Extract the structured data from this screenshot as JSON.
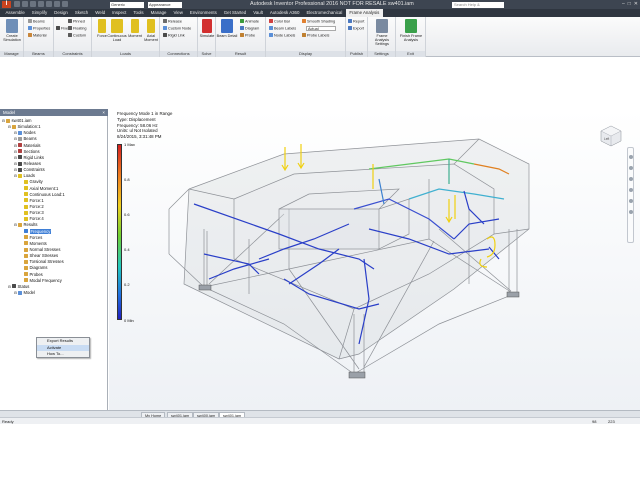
{
  "titlebar": {
    "title": "Autodesk Inventor Professional 2016    NOT FOR RESALE    sw401.iam",
    "material_combo": "Generic",
    "appearance_combo": "Appearance",
    "search_placeholder": "Search Help & Commands...",
    "logo_letter": "I"
  },
  "tabs": [
    "Assemble",
    "Simplify",
    "Design",
    "Sketch",
    "Weld",
    "Inspect",
    "Tools",
    "Manage",
    "View",
    "Environments",
    "Get Started",
    "Vault",
    "Autodesk A360",
    "Electromechanical",
    "Frame Analysis"
  ],
  "active_tab_index": 14,
  "ribbon": {
    "manage": {
      "label": "Manage",
      "button": "Create Simulation"
    },
    "beams": {
      "label": "Beams",
      "properties": "Properties",
      "material": "Material",
      "beams_btn": "Beams"
    },
    "constraints": {
      "label": "Constraints",
      "fixed": "Fixed",
      "pinned": "Pinned",
      "floating": "Floating",
      "custom": "Custom"
    },
    "loads": {
      "label": "Loads",
      "force": "Force",
      "continuous": "Continuous Load",
      "moment": "Moment",
      "axial_moment": "Axial Moment"
    },
    "connections": {
      "label": "Connections",
      "release": "Release",
      "custom_node": "Custom Node",
      "rigid_link": "Rigid Link"
    },
    "solve": {
      "label": "Solve",
      "simulate": "Simulate"
    },
    "result": {
      "label": "Result",
      "beam_detail": "Beam Detail",
      "animate": "Animate",
      "diagram": "Diagram",
      "probe": "Probe"
    },
    "display": {
      "label": "Display",
      "color_bar": "Color Bar",
      "smooth_shading": "Smooth Shading",
      "beam_labels": "Beam Labels",
      "node_labels": "Node Labels",
      "probe_labels": "Probe Labels",
      "actual_select": "Actual"
    },
    "publish": {
      "label": "Publish",
      "report": "Report",
      "export": "Export"
    },
    "settings": {
      "label": "Settings",
      "button": "Frame Analysis Settings"
    },
    "exit": {
      "label": "Exit",
      "button": "Finish Frame Analysis"
    }
  },
  "browser": {
    "header": "Model",
    "tree": [
      {
        "label": "sw401.iam",
        "indent": 0,
        "color": "#d9a43c"
      },
      {
        "label": "Simulation:1",
        "indent": 1,
        "color": "#d9a43c"
      },
      {
        "label": "Nodes",
        "indent": 2,
        "color": "#5a8fd8"
      },
      {
        "label": "Beams",
        "indent": 2,
        "color": "#9a9a9a"
      },
      {
        "label": "Materials",
        "indent": 2,
        "color": "#b04040"
      },
      {
        "label": "Sections",
        "indent": 2,
        "color": "#b04040"
      },
      {
        "label": "Rigid Links",
        "indent": 2,
        "color": "#4a4a4a"
      },
      {
        "label": "Releases",
        "indent": 2,
        "color": "#4a4a4a"
      },
      {
        "label": "Constraints",
        "indent": 2,
        "color": "#4a4a4a"
      },
      {
        "label": "Loads",
        "indent": 2,
        "color": "#e0c020"
      },
      {
        "label": "Gravity",
        "indent": 3,
        "color": "#e0c020"
      },
      {
        "label": "Axial Moment:1",
        "indent": 3,
        "color": "#e0c020"
      },
      {
        "label": "Continuous Load:1",
        "indent": 3,
        "color": "#e0c020"
      },
      {
        "label": "Force:1",
        "indent": 3,
        "color": "#e0c020"
      },
      {
        "label": "Force:2",
        "indent": 3,
        "color": "#e0c020"
      },
      {
        "label": "Force:3",
        "indent": 3,
        "color": "#e0c020"
      },
      {
        "label": "Force:4",
        "indent": 3,
        "color": "#e0c020"
      },
      {
        "label": "Results",
        "indent": 2,
        "color": "#d9a43c"
      },
      {
        "label": "Frequency",
        "indent": 3,
        "color": "#3f7fd6",
        "selected": true
      },
      {
        "label": "Forces",
        "indent": 3,
        "color": "#d9a43c"
      },
      {
        "label": "Moments",
        "indent": 3,
        "color": "#d9a43c"
      },
      {
        "label": "Normal Stresses",
        "indent": 3,
        "color": "#d9a43c"
      },
      {
        "label": "Shear Stresses",
        "indent": 3,
        "color": "#d9a43c"
      },
      {
        "label": "Torsional Stresses",
        "indent": 3,
        "color": "#d9a43c"
      },
      {
        "label": "Diagrams",
        "indent": 3,
        "color": "#d9a43c"
      },
      {
        "label": "Probes",
        "indent": 3,
        "color": "#d9a43c"
      },
      {
        "label": "Modal Frequency",
        "indent": 3,
        "color": "#d9a43c"
      },
      {
        "label": "Status",
        "indent": 1,
        "color": "#4a4a4a"
      },
      {
        "label": "Model",
        "indent": 2,
        "color": "#5a8fd8"
      }
    ],
    "context_menu": [
      "Export Results",
      "Activate",
      "How To..."
    ],
    "context_menu_highlight": 1
  },
  "graphics": {
    "info_lines": [
      "Frequency Mode 1 in Range",
      "Type: Displacement",
      "Frequency: 58.06 Hz",
      "Units: ul Not Isolated",
      "8/24/2015, 3:31:48 PM"
    ],
    "legend": [
      {
        "label": "1 Max",
        "pos": 0
      },
      {
        "label": "0.8",
        "pos": 0.2
      },
      {
        "label": "0.6",
        "pos": 0.4
      },
      {
        "label": "0.4",
        "pos": 0.6
      },
      {
        "label": "0.2",
        "pos": 0.8
      },
      {
        "label": "0 Min",
        "pos": 1
      }
    ],
    "viewcube_label": "Left"
  },
  "doc_tabs": [
    "My Home",
    "sw401.iam",
    "sw400.iam",
    "sw401.iam"
  ],
  "active_doc_tab": 3,
  "status": {
    "text": "Ready",
    "count_a": "98",
    "count_b": "223"
  }
}
